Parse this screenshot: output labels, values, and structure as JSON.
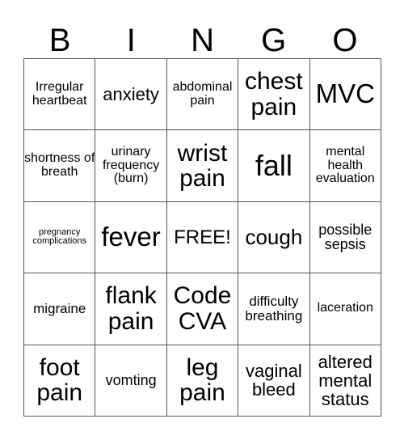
{
  "header": [
    "B",
    "I",
    "N",
    "G",
    "O"
  ],
  "rows": [
    [
      "Irregular heartbeat",
      "anxiety",
      "abdominal pain",
      "chest pain",
      "MVC"
    ],
    [
      "shortness of breath",
      "urinary frequency (burn)",
      "wrist pain",
      "fall",
      "mental health evaluation"
    ],
    [
      "pregnancy complications",
      "fever",
      "FREE!",
      "cough",
      "possible sepsis"
    ],
    [
      "migraine",
      "flank pain",
      "Code CVA",
      "difficulty breathing",
      "laceration"
    ],
    [
      "foot pain",
      "vomting",
      "leg pain",
      "vaginal bleed",
      "altered mental status"
    ]
  ]
}
